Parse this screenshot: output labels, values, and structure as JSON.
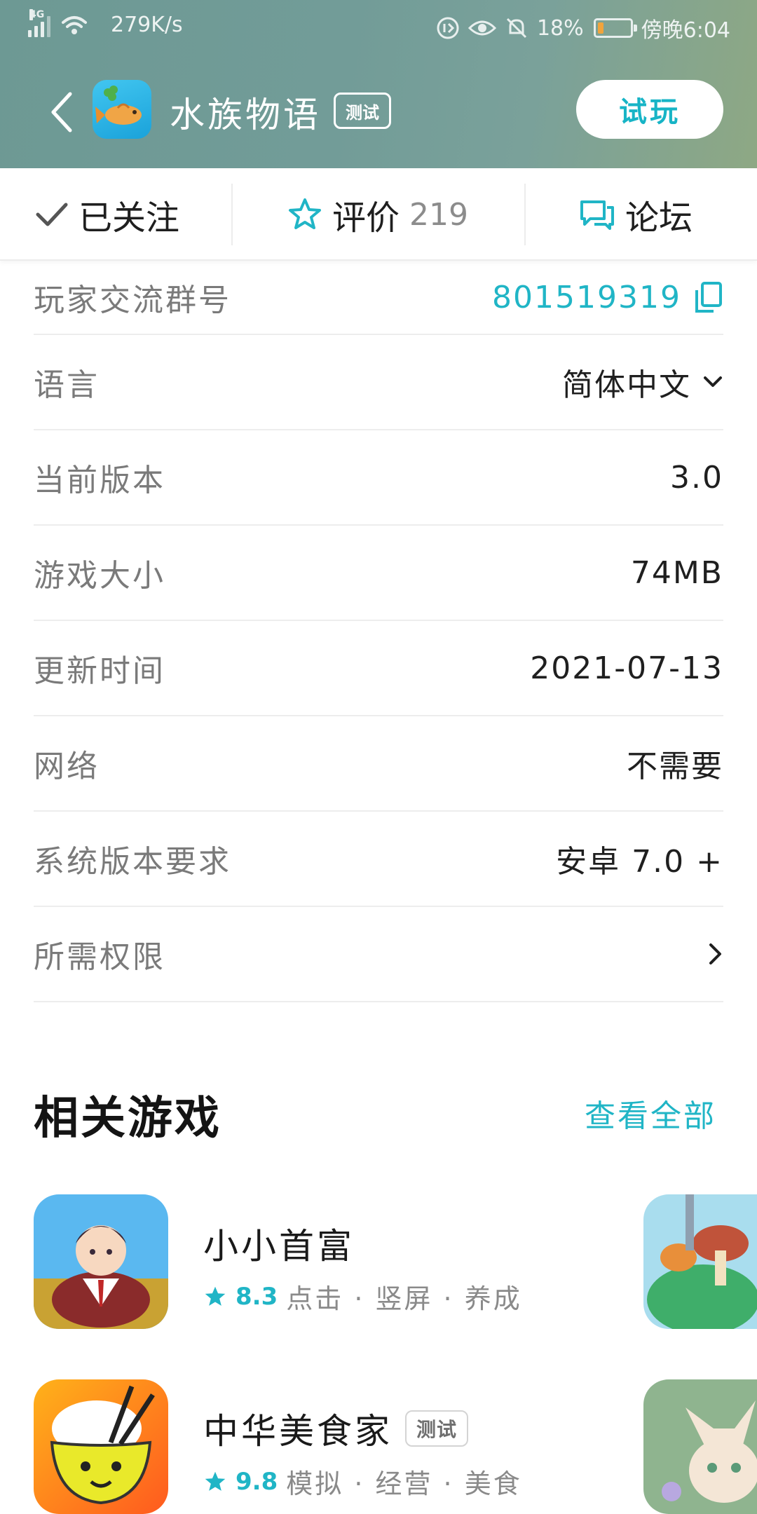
{
  "status_bar": {
    "network": "4G",
    "speed": "279K/s",
    "battery_percent": "18%",
    "time": "傍晚6:04",
    "battery_level": 0.18,
    "battery_color": "#f1a43c"
  },
  "header": {
    "back_icon": "chevron-left-icon",
    "app_icon": "fish-app-icon",
    "title": "水族物语",
    "badge": "测试",
    "try_button": "试玩"
  },
  "action_bar": {
    "follow_label": "已关注",
    "rate_label": "评价",
    "rate_count": "219",
    "forum_label": "论坛"
  },
  "info": {
    "group": {
      "label": "玩家交流群号",
      "value": "801519319",
      "icon": "copy-icon"
    },
    "language": {
      "label": "语言",
      "value": "简体中文",
      "icon": "chevron-down-icon"
    },
    "version": {
      "label": "当前版本",
      "value": "3.0"
    },
    "size": {
      "label": "游戏大小",
      "value": "74MB"
    },
    "updated": {
      "label": "更新时间",
      "value": "2021-07-13"
    },
    "network": {
      "label": "网络",
      "value": "不需要"
    },
    "os": {
      "label": "系统版本要求",
      "value": "安卓 7.0 +"
    },
    "permissions": {
      "label": "所需权限",
      "icon": "chevron-right-icon"
    }
  },
  "related": {
    "title": "相关游戏",
    "see_all": "查看全部",
    "games": [
      {
        "name": "小小首富",
        "score": "8.3",
        "tags": "点击 · 竖屏 · 养成",
        "badge": ""
      },
      {
        "name": "中华美食家",
        "score": "9.8",
        "tags": "模拟 · 经营 · 美食",
        "badge": "测试"
      }
    ]
  },
  "colors": {
    "accent": "#20b5c6",
    "header_bg": "#739c97"
  }
}
